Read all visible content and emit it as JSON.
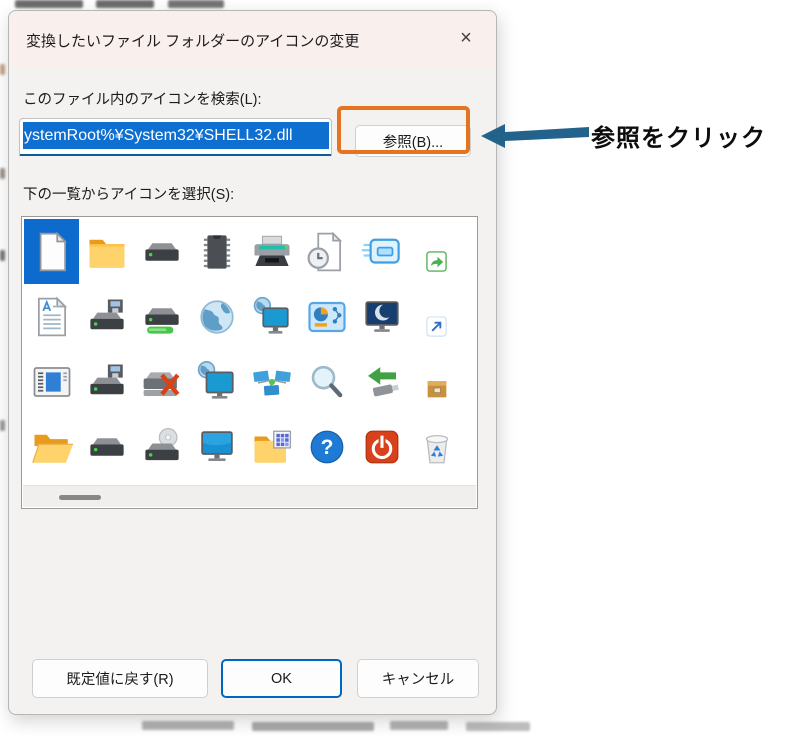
{
  "window": {
    "title": "変換したいファイル フォルダーのアイコンの変更",
    "close_glyph": "×"
  },
  "search": {
    "label": "このファイル内のアイコンを検索(L):",
    "value": "ystemRoot%¥System32¥SHELL32.dll",
    "browse_label": "参照(B)..."
  },
  "icon_list": {
    "label": "下の一覧からアイコンを選択(S):",
    "selected": {
      "row": 0,
      "col": 0
    },
    "rows": [
      [
        "blank-document",
        "folder",
        "hard-drive",
        "memory-chip",
        "printer",
        "document-clock",
        "window-fast",
        "share-overlay"
      ],
      [
        "text-document",
        "drive-floppy",
        "drive-loading",
        "globe",
        "monitor-network",
        "system-panel",
        "monitor-night",
        "shortcut-overlay"
      ],
      [
        "window-settings",
        "drive-floppy",
        "drive-error",
        "monitor-globe",
        "network-nodes",
        "magnifier",
        "usb-transfer",
        "package-box"
      ],
      [
        "folder-open",
        "hard-drive",
        "drive-cd",
        "monitor",
        "folder-programs",
        "help",
        "power",
        "recycle-bin"
      ]
    ]
  },
  "footer": {
    "reset_label": "既定値に戻す(R)",
    "ok_label": "OK",
    "cancel_label": "キャンセル"
  },
  "annotation": {
    "text": "参照をクリック",
    "highlight_color": "#E4741F",
    "arrow_color": "#23638B"
  },
  "colors": {
    "selection_blue": "#0E6FD0",
    "input_accent": "#0A5C9E",
    "titlebar_bg": "#F9EFED",
    "dialog_bg": "#F3F2F1",
    "selected_cell": "#0D6BCE",
    "ok_focus_border": "#0067C0"
  }
}
